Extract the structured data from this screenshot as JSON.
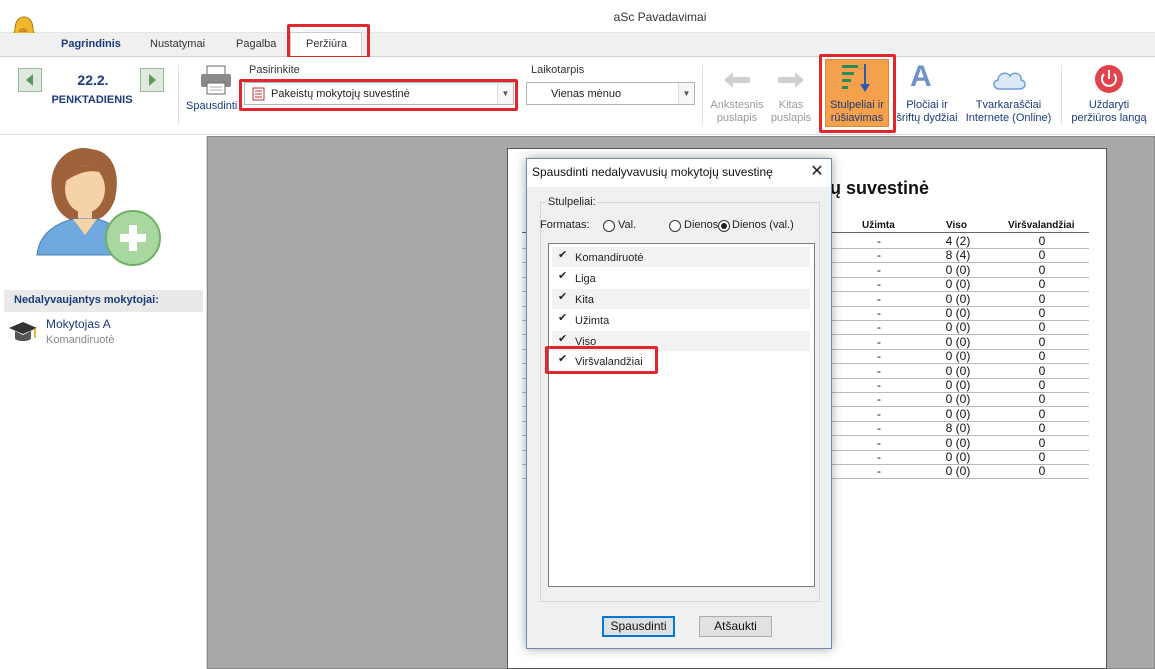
{
  "window": {
    "title": "aSc Pavadavimai",
    "logo_text": "aSc"
  },
  "tabs": [
    {
      "label": "Pagrindinis"
    },
    {
      "label": "Nustatymai"
    },
    {
      "label": "Pagalba"
    },
    {
      "label": "Peržiūra"
    }
  ],
  "active_tab": "Peržiūra",
  "date_nav": {
    "date": "22.2.",
    "day": "PENKTADIENIS"
  },
  "ribbon": {
    "print_label": "Spausdinti",
    "select_label": "Pasirinkite",
    "select_value": "Pakeistų mokytojų suvestinė",
    "period_label": "Laikotarpis",
    "period_value": "Vienas mėnuo",
    "prev_page": [
      "Ankstesnis",
      "puslapis"
    ],
    "next_page": [
      "Kitas",
      "puslapis"
    ],
    "columns_btn": [
      "Stulpeliai ir",
      "rūšiavimas"
    ],
    "widths_btn": [
      "Pločiai ir",
      "šriftų dydžiai"
    ],
    "online_btn": [
      "Tvarkaraščiai",
      "Internete (Online)"
    ],
    "close_btn": [
      "Uždaryti",
      "peržiūros langą"
    ]
  },
  "left_panel": {
    "header": "Nedalyvaujantys mokytojai:",
    "teacher_name": "Mokytojas A",
    "teacher_reason": "Komandiruotė"
  },
  "report": {
    "title_fragment": "ų suvestinė",
    "headers": [
      "Užimta",
      "Viso",
      "Viršvalandžiai"
    ],
    "rows": [
      [
        "-",
        "4 (2)",
        "0"
      ],
      [
        "-",
        "8 (4)",
        "0"
      ],
      [
        "-",
        "0 (0)",
        "0"
      ],
      [
        "-",
        "0 (0)",
        "0"
      ],
      [
        "-",
        "0 (0)",
        "0"
      ],
      [
        "-",
        "0 (0)",
        "0"
      ],
      [
        "-",
        "0 (0)",
        "0"
      ],
      [
        "-",
        "0 (0)",
        "0"
      ],
      [
        "-",
        "0 (0)",
        "0"
      ],
      [
        "-",
        "0 (0)",
        "0"
      ],
      [
        "-",
        "0 (0)",
        "0"
      ],
      [
        "-",
        "0 (0)",
        "0"
      ],
      [
        "-",
        "0 (0)",
        "0"
      ],
      [
        "-",
        "8 (0)",
        "0"
      ],
      [
        "-",
        "0 (0)",
        "0"
      ],
      [
        "-",
        "0 (0)",
        "0"
      ],
      [
        "-",
        "0 (0)",
        "0"
      ]
    ]
  },
  "dialog": {
    "title": "Spausdinti nedalyvavusių mokytojų suvestinę",
    "group_label": "Stulpeliai:",
    "format_label": "Formatas:",
    "format_options": [
      "Val.",
      "Dienos",
      "Dienos (val.)"
    ],
    "format_selected": "Dienos (val.)",
    "columns": [
      {
        "label": "Komandiruotė",
        "checked": true
      },
      {
        "label": "Liga",
        "checked": true
      },
      {
        "label": "Kita",
        "checked": true
      },
      {
        "label": "Užimta",
        "checked": true
      },
      {
        "label": "Viso",
        "checked": true
      },
      {
        "label": "Viršvalandžiai",
        "checked": true
      }
    ],
    "print_button": "Spausdinti",
    "cancel_button": "Atšaukti"
  },
  "colors": {
    "accent": "#1a3b7a",
    "highlight": "#e2262e",
    "active_ribbon": "#f5a04a"
  }
}
